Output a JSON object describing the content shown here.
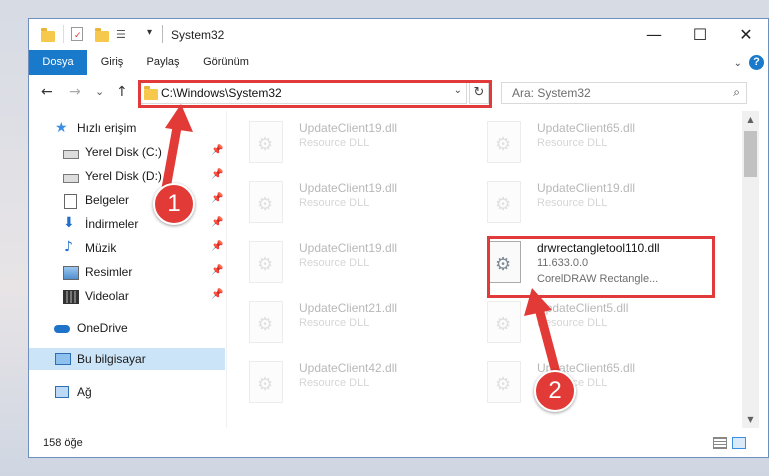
{
  "window": {
    "title": "System32"
  },
  "window_controls": {
    "minimize": "—",
    "maximize": "☐",
    "close": "✕"
  },
  "ribbon": {
    "tabs": [
      "Dosya",
      "Giriş",
      "Paylaş",
      "Görünüm"
    ],
    "help": "?"
  },
  "nav": {
    "back": "←",
    "forward": "→",
    "recent": "⌄",
    "up": "↑",
    "address": "C:\\Windows\\System32",
    "refresh": "↻",
    "search_placeholder": "Ara: System32"
  },
  "sidebar": {
    "items": [
      {
        "label": "Hızlı erişim",
        "icon": "star-icon",
        "pinned": false
      },
      {
        "label": "Yerel Disk (C:)",
        "icon": "drive-icon",
        "pinned": true
      },
      {
        "label": "Yerel Disk (D:)",
        "icon": "drive-icon",
        "pinned": true
      },
      {
        "label": "Belgeler",
        "icon": "documents-icon",
        "pinned": true
      },
      {
        "label": "İndirmeler",
        "icon": "download-icon",
        "pinned": true
      },
      {
        "label": "Müzik",
        "icon": "music-icon",
        "pinned": true
      },
      {
        "label": "Resimler",
        "icon": "pictures-icon",
        "pinned": true
      },
      {
        "label": "Videolar",
        "icon": "videos-icon",
        "pinned": true
      },
      {
        "label": "OneDrive",
        "icon": "cloud-icon",
        "pinned": false
      },
      {
        "label": "Bu bilgisayar",
        "icon": "computer-icon",
        "pinned": false
      },
      {
        "label": "Ağ",
        "icon": "network-icon",
        "pinned": false
      }
    ]
  },
  "files": [
    {
      "name": "UpdateClient19.dll",
      "desc": "Resource DLL"
    },
    {
      "name": "UpdateClient65.dll",
      "desc": "Resource DLL"
    },
    {
      "name": "UpdateClient19.dll",
      "desc": "Resource DLL"
    },
    {
      "name": "UpdateClient19.dll",
      "desc": "Resource DLL"
    },
    {
      "name": "UpdateClient19.dll",
      "desc": "Resource DLL"
    },
    {
      "name": "drwrectangletool110.dll",
      "desc": "11.633.0.0",
      "desc2": "CorelDRAW Rectangle..."
    },
    {
      "name": "UpdateClient21.dll",
      "desc": "Resource DLL"
    },
    {
      "name": "UpdateClient5.dll",
      "desc": "Resource DLL"
    },
    {
      "name": "UpdateClient42.dll",
      "desc": "Resource DLL"
    },
    {
      "name": "UpdateClient65.dll",
      "desc": "Resource DLL"
    }
  ],
  "status": {
    "count": "158 öğe"
  },
  "annotations": {
    "badge1": "1",
    "badge2": "2",
    "color": "#e23a36"
  }
}
